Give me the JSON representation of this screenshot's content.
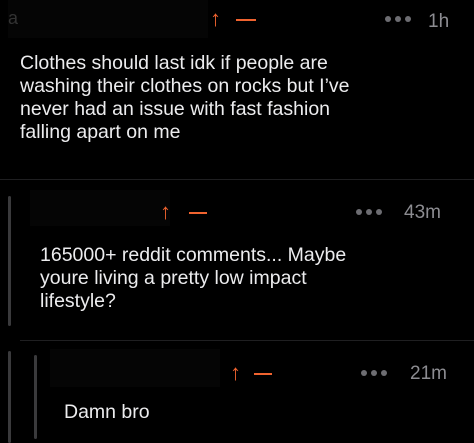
{
  "colors": {
    "background": "#000000",
    "text": "#ececee",
    "muted": "#8c8c91",
    "vote_accent": "#f0632f",
    "thread_line": "#3a3a3c"
  },
  "comments": [
    {
      "author_visible": "a",
      "timestamp": "1h",
      "body": "Clothes should last idk if people are\nwashing their clothes on rocks but I’ve\nnever had an issue with fast fashion\nfalling apart on me",
      "upvote_icon": "upvote-arrow-icon",
      "downvote_icon": "downvote-dash-icon",
      "more_icon": "more-dots-icon"
    },
    {
      "timestamp": "43m",
      "body": "165000+ reddit comments... Maybe\nyoure living a pretty low impact\nlifestyle?",
      "upvote_icon": "upvote-arrow-icon",
      "downvote_icon": "downvote-dash-icon",
      "more_icon": "more-dots-icon"
    },
    {
      "timestamp": "21m",
      "body": "Damn bro",
      "upvote_icon": "upvote-arrow-icon",
      "downvote_icon": "downvote-dash-icon",
      "more_icon": "more-dots-icon"
    }
  ]
}
